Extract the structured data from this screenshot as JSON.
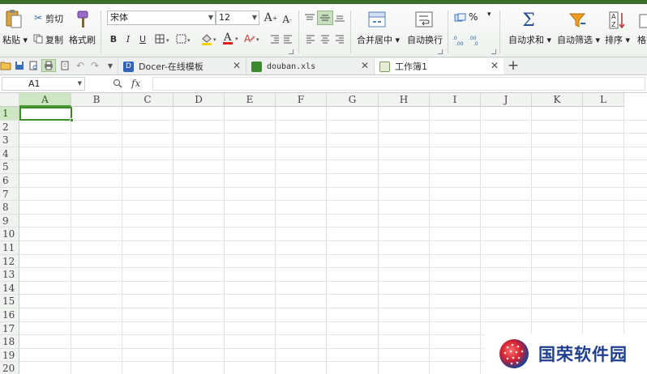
{
  "ribbon": {
    "clipboard": {
      "paste": "粘贴",
      "cut": "剪切",
      "copy": "复制",
      "format_painter": "格式刷"
    },
    "font": {
      "name": "宋体",
      "size": "12",
      "bold": "B",
      "italic": "I",
      "underline": "U",
      "grow": "A",
      "shrink": "A",
      "font_color_letter": "A"
    },
    "alignment": {
      "merge_center": "合并居中",
      "wrap_text": "自动换行"
    },
    "number": {
      "percent": "%",
      "dec_inc": ".0 .00",
      "dec_dec": ".00 .0"
    },
    "editing": {
      "autosum": "自动求和",
      "autofilter": "自动筛选",
      "sort": "排序",
      "format": "格式"
    }
  },
  "quick_access": {},
  "tabs": [
    {
      "label": "Docer-在线模板",
      "icon": "docer-icon",
      "active": false
    },
    {
      "label": "douban.xls",
      "icon": "xls-icon",
      "active": false
    },
    {
      "label": "工作簿1",
      "icon": "workbook-icon",
      "active": true
    }
  ],
  "formula_bar": {
    "cell_ref": "A1",
    "fx": "fx",
    "value": ""
  },
  "columns": [
    "A",
    "B",
    "C",
    "D",
    "E",
    "F",
    "G",
    "H",
    "I",
    "J",
    "K",
    "L"
  ],
  "rows": [
    "1",
    "2",
    "3",
    "4",
    "5",
    "6",
    "7",
    "8",
    "9",
    "10",
    "11",
    "12",
    "13",
    "14",
    "15",
    "16",
    "17",
    "18",
    "19",
    "20"
  ],
  "selected_cell": "A1",
  "watermark": {
    "text": "国荣软件园"
  },
  "colors": {
    "accent": "#3f8a2a",
    "header_bg": "#f1f3f1",
    "selected_header": "#cfe6c4"
  }
}
